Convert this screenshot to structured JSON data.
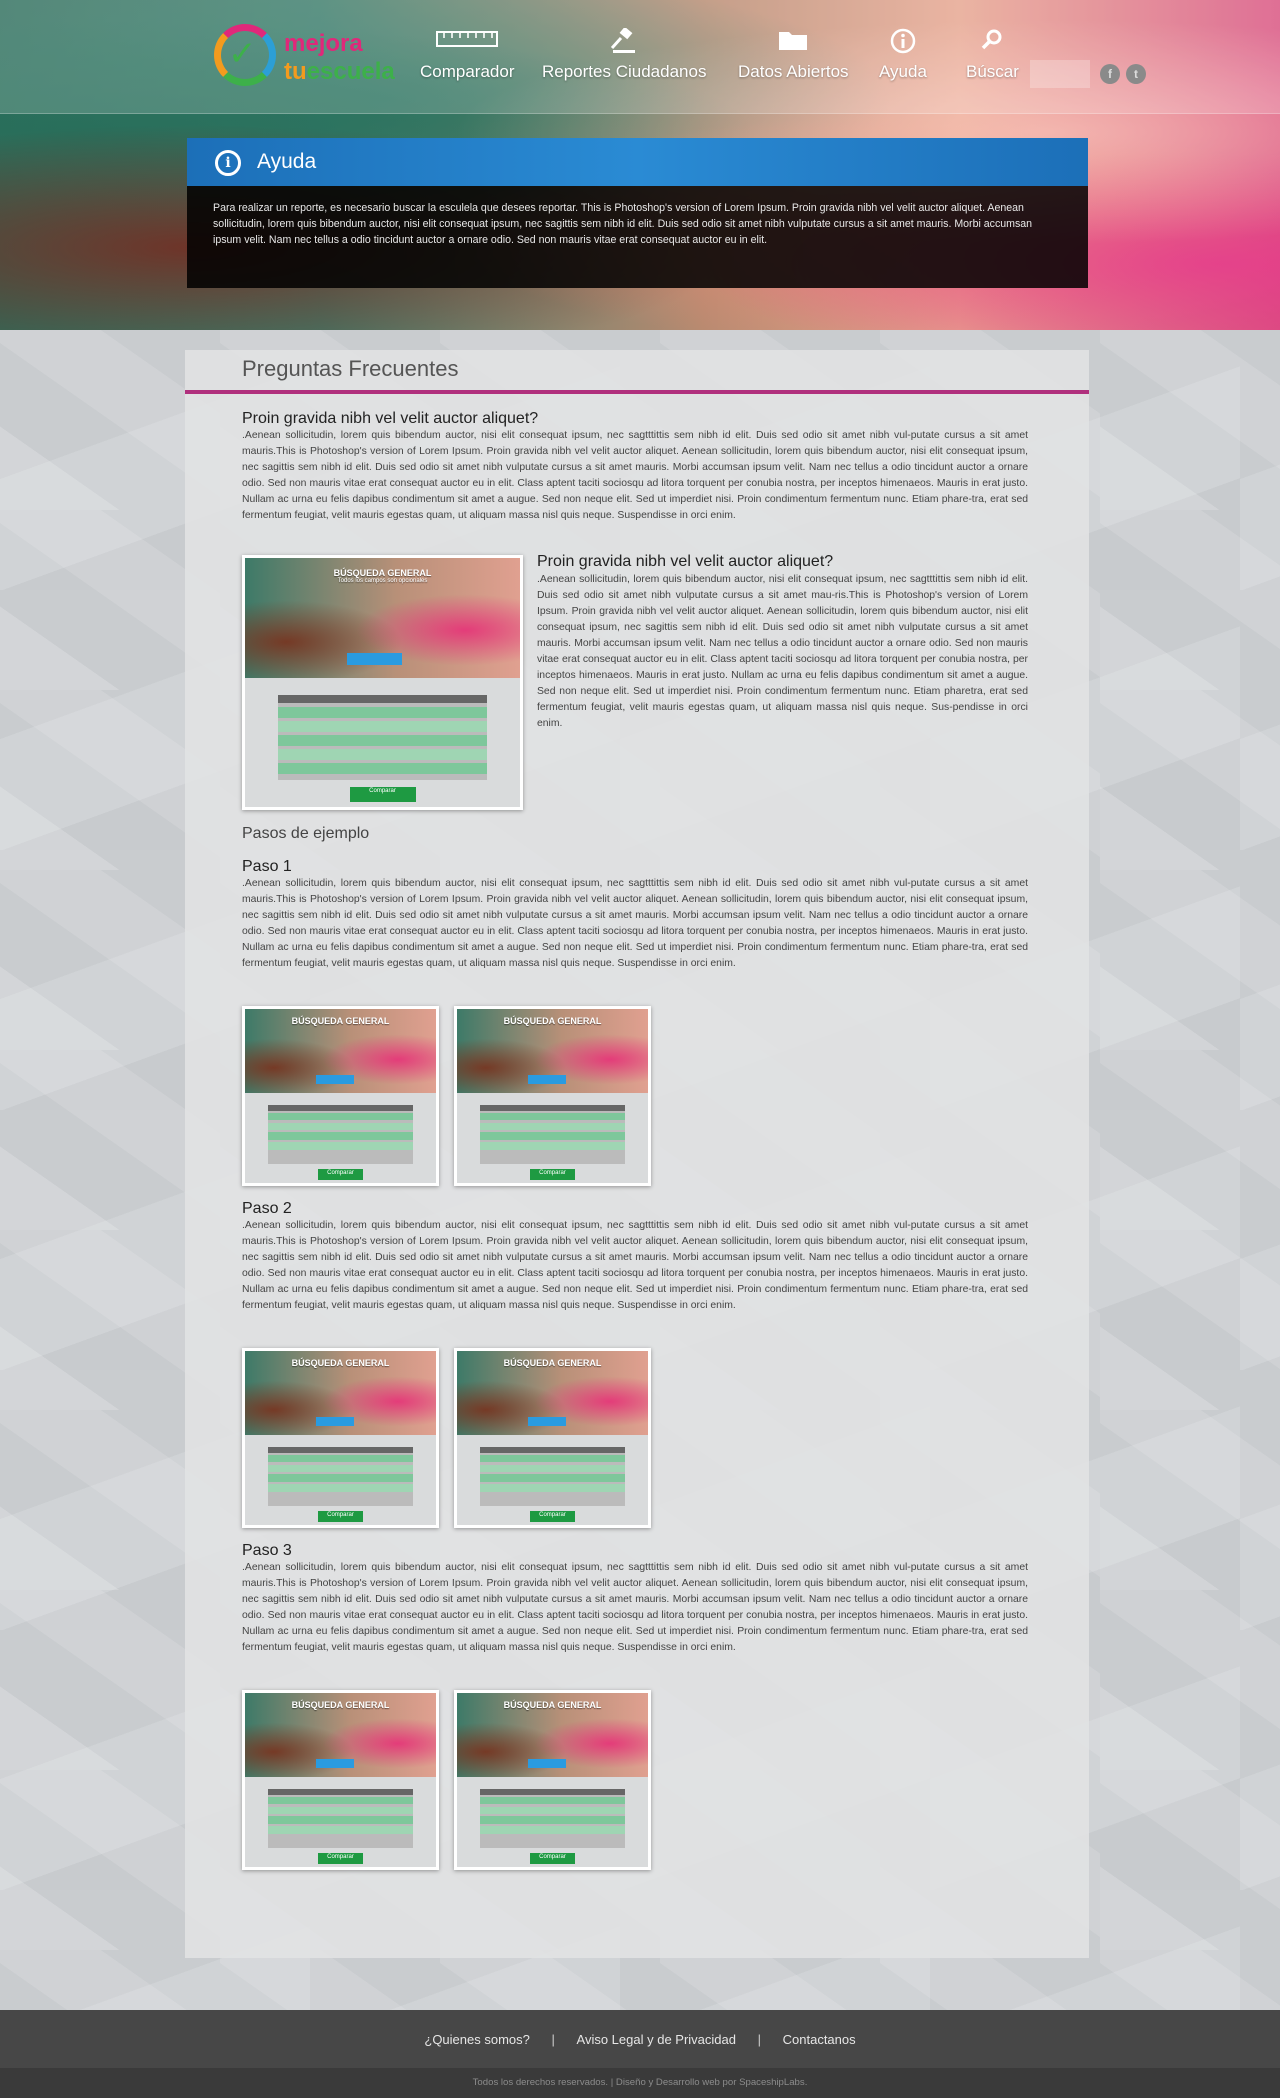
{
  "brand": {
    "line1": "mejora",
    "line2_prefix": "tu",
    "line2_rest": "escuela"
  },
  "nav": {
    "items": [
      {
        "label": "Comparador",
        "icon": "ruler-icon"
      },
      {
        "label": "Reportes Ciudadanos",
        "icon": "gavel-icon"
      },
      {
        "label": "Datos Abiertos",
        "icon": "folder-icon"
      },
      {
        "label": "Ayuda",
        "icon": "info-icon"
      },
      {
        "label": "Búscar",
        "icon": "search-icon"
      }
    ],
    "social": [
      "f",
      "t"
    ]
  },
  "ayuda": {
    "title": "Ayuda",
    "text": "Para  realizar un reporte, es necesario buscar la esculela que desees reportar. This is Photoshop's version  of Lorem Ipsum. Proin gravida nibh vel velit auctor aliquet. Aenean sollicitudin, lorem quis bibendum auctor, nisi elit consequat ipsum, nec sagittis sem nibh id elit. Duis sed odio sit amet nibh vulputate cursus a sit amet mauris. Morbi accumsan ipsum velit. Nam nec tellus a odio tincidunt auctor a ornare odio. Sed non  mauris vitae erat consequat auctor eu in elit."
  },
  "faq": {
    "title": "Preguntas Frecuentes",
    "q1": {
      "title": "Proin gravida nibh vel velit auctor aliquet?",
      "text": ".Aenean sollicitudin, lorem quis bibendum auctor, nisi elit consequat ipsum, nec sagtttittis sem nibh id elit. Duis sed odio sit amet nibh vul-putate cursus a sit amet mauris.This is Photoshop's version  of Lorem Ipsum. Proin gravida nibh vel velit auctor aliquet. Aenean sollicitudin, lorem quis bibendum auctor, nisi elit consequat ipsum, nec sagittis sem nibh id elit. Duis sed odio sit amet nibh vulputate cursus a sit amet mauris. Morbi accumsan ipsum velit. Nam nec tellus a odio tincidunt auctor a ornare odio. Sed non  mauris vitae erat consequat auctor eu in elit. Class aptent taciti sociosqu ad litora torquent per conubia nostra, per inceptos himenaeos. Mauris in erat justo. Nullam ac urna eu felis dapibus condimentum sit amet a augue. Sed non neque elit. Sed ut imperdiet nisi. Proin condimentum fermentum nunc. Etiam phare-tra, erat sed fermentum feugiat, velit mauris egestas quam, ut aliquam massa nisl quis neque. Suspendisse in orci enim."
    },
    "q2": {
      "title": "Proin gravida nibh vel velit auctor aliquet?",
      "text": ".Aenean sollicitudin, lorem quis bibendum auctor, nisi elit consequat ipsum, nec sagtttittis sem nibh id elit. Duis sed odio sit amet nibh vulputate cursus a sit amet mau-ris.This is Photoshop's version  of Lorem Ipsum. Proin gravida nibh vel velit auctor aliquet. Aenean sollicitudin, lorem quis bibendum auctor, nisi elit consequat ipsum, nec sagittis sem nibh id elit. Duis sed odio sit amet nibh vulputate cursus a sit amet mauris. Morbi accumsan ipsum velit. Nam nec tellus a odio tincidunt auctor a ornare odio. Sed non  mauris vitae erat consequat auctor eu in elit. Class aptent taciti sociosqu ad litora torquent per conubia nostra, per inceptos himenaeos. Mauris in erat justo. Nullam ac urna eu felis dapibus condimentum sit amet a augue. Sed non neque elit. Sed ut imperdiet nisi. Proin condimentum fermentum nunc. Etiam pharetra, erat sed fermentum feugiat, velit mauris egestas quam, ut aliquam massa nisl quis neque. Sus-pendisse in orci enim."
    },
    "examples_title": "Pasos de ejemplo",
    "steps": [
      {
        "title": "Paso 1",
        "text": ".Aenean sollicitudin, lorem quis bibendum auctor, nisi elit consequat ipsum, nec sagtttittis sem nibh id elit. Duis sed odio sit amet nibh vul-putate cursus a sit amet mauris.This is Photoshop's version  of Lorem Ipsum. Proin gravida nibh vel velit auctor aliquet. Aenean sollicitudin, lorem quis bibendum auctor, nisi elit consequat ipsum, nec sagittis sem nibh id elit. Duis sed odio sit amet nibh vulputate cursus a sit amet mauris. Morbi accumsan ipsum velit. Nam nec tellus a odio tincidunt auctor a ornare odio. Sed non  mauris vitae erat consequat auctor eu in elit. Class aptent taciti sociosqu ad litora torquent per conubia nostra, per inceptos himenaeos. Mauris in erat justo. Nullam ac urna eu felis dapibus condimentum sit amet a augue. Sed non neque elit. Sed ut imperdiet nisi. Proin condimentum fermentum nunc. Etiam phare-tra, erat sed fermentum feugiat, velit mauris egestas quam, ut aliquam massa nisl quis neque. Suspendisse in orci enim."
      },
      {
        "title": "Paso 2",
        "text": ".Aenean sollicitudin, lorem quis bibendum auctor, nisi elit consequat ipsum, nec sagtttittis sem nibh id elit. Duis sed odio sit amet nibh vul-putate cursus a sit amet mauris.This is Photoshop's version  of Lorem Ipsum. Proin gravida nibh vel velit auctor aliquet. Aenean sollicitudin, lorem quis bibendum auctor, nisi elit consequat ipsum, nec sagittis sem nibh id elit. Duis sed odio sit amet nibh vulputate cursus a sit amet mauris. Morbi accumsan ipsum velit. Nam nec tellus a odio tincidunt auctor a ornare odio. Sed non  mauris vitae erat consequat auctor eu in elit. Class aptent taciti sociosqu ad litora torquent per conubia nostra, per inceptos himenaeos. Mauris in erat justo. Nullam ac urna eu felis dapibus condimentum sit amet a augue. Sed non neque elit. Sed ut imperdiet nisi. Proin condimentum fermentum nunc. Etiam phare-tra, erat sed fermentum feugiat, velit mauris egestas quam, ut aliquam massa nisl quis neque. Suspendisse in orci enim."
      },
      {
        "title": "Paso 3",
        "text": ".Aenean sollicitudin, lorem quis bibendum auctor, nisi elit consequat ipsum, nec sagtttittis sem nibh id elit. Duis sed odio sit amet nibh vul-putate cursus a sit amet mauris.This is Photoshop's version  of Lorem Ipsum. Proin gravida nibh vel velit auctor aliquet. Aenean sollicitudin, lorem quis bibendum auctor, nisi elit consequat ipsum, nec sagittis sem nibh id elit. Duis sed odio sit amet nibh vulputate cursus a sit amet mauris. Morbi accumsan ipsum velit. Nam nec tellus a odio tincidunt auctor a ornare odio. Sed non  mauris vitae erat consequat auctor eu in elit. Class aptent taciti sociosqu ad litora torquent per conubia nostra, per inceptos himenaeos. Mauris in erat justo. Nullam ac urna eu felis dapibus condimentum sit amet a augue. Sed non neque elit. Sed ut imperdiet nisi. Proin condimentum fermentum nunc. Etiam phare-tra, erat sed fermentum feugiat, velit mauris egestas quam, ut aliquam massa nisl quis neque. Suspendisse in orci enim."
      }
    ],
    "thumb": {
      "title": "BÚSQUEDA GENERAL",
      "subtitle": "Todos los campos son opcionales",
      "compare": "Comparar"
    }
  },
  "footer": {
    "links": [
      "¿Quienes somos?",
      "Aviso Legal  y  de Privacidad",
      "Contactanos"
    ],
    "separator": "|",
    "copyright": "Todos los derechos reservados. | Diseño y Desarrollo web por SpaceshipLabs."
  },
  "colors": {
    "accent": "#b0307d",
    "blue": "#1c6fb8",
    "green": "#1e9a42"
  }
}
